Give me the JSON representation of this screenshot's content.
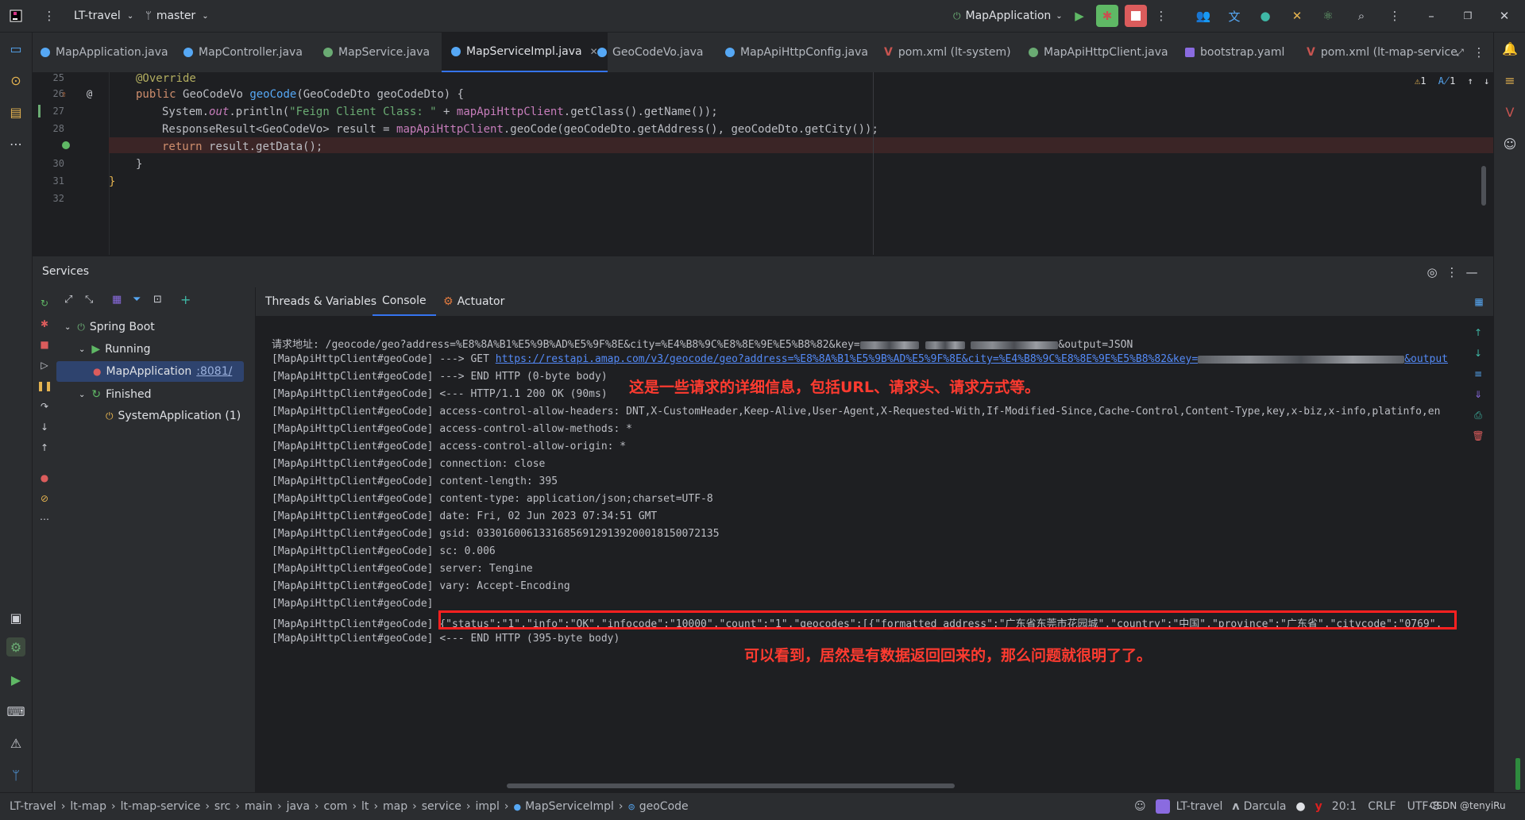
{
  "titlebar": {
    "project": "LT-travel",
    "branch": "master",
    "run_config": "MapApplication"
  },
  "tabs": [
    {
      "label": "MapApplication.java",
      "icon": "java-class-icon",
      "color": "#56a8f5"
    },
    {
      "label": "MapController.java",
      "icon": "java-class-icon",
      "color": "#56a8f5"
    },
    {
      "label": "MapService.java",
      "icon": "java-interface-icon",
      "color": "#6aab73"
    },
    {
      "label": "MapServiceImpl.java",
      "icon": "java-class-icon",
      "color": "#56a8f5",
      "active": true
    },
    {
      "label": "GeoCodeVo.java",
      "icon": "java-class-icon",
      "color": "#56a8f5"
    },
    {
      "label": "MapApiHttpConfig.java",
      "icon": "java-class-icon",
      "color": "#56a8f5"
    },
    {
      "label": "pom.xml (lt-system)",
      "icon": "maven-icon",
      "color": "#c75450"
    },
    {
      "label": "MapApiHttpClient.java",
      "icon": "java-interface-icon",
      "color": "#6aab73"
    },
    {
      "label": "bootstrap.yaml",
      "icon": "yaml-icon",
      "color": "#8a6be0"
    },
    {
      "label": "pom.xml (lt-map-service",
      "icon": "maven-icon",
      "color": "#c75450"
    }
  ],
  "editor": {
    "lines": [
      {
        "n": "25",
        "text": "@Override"
      },
      {
        "n": "26",
        "text": "public GeoCodeVo geoCode(GeoCodeDto geoCodeDto) {"
      },
      {
        "n": "27",
        "text": "System.out.println(\"Feign Client Class: \" + mapApiHttpClient.getClass().getName());"
      },
      {
        "n": "28",
        "text": "ResponseResult<GeoCodeVo> result = mapApiHttpClient.geoCode(geoCodeDto.getAddress(), geoCodeDto.getCity());"
      },
      {
        "n": "",
        "text": "return result.getData();"
      },
      {
        "n": "30",
        "text": "}"
      },
      {
        "n": "31",
        "text": "}"
      },
      {
        "n": "32",
        "text": ""
      }
    ],
    "inspections": {
      "warnings": "1",
      "typos": "1"
    }
  },
  "services": {
    "title": "Services",
    "tree": {
      "root": "Spring Boot",
      "running": "Running",
      "running_app": "MapApplication",
      "running_port": ":8081/",
      "finished": "Finished",
      "finished_app": "SystemApplication (1)"
    },
    "console_tabs": [
      "Threads & Variables",
      "Console",
      "Actuator"
    ],
    "active_console_tab": "Console"
  },
  "console": {
    "line0_prefix": "请求地址: /geocode/geo?address=%E8%8A%B1%E5%9B%AD%E5%9F%8E&city=%E4%B8%9C%E8%8E%9E%E5%B8%82&key=",
    "line0_suffix": "&output=JSON",
    "line1_prefix": "[MapApiHttpClient#geoCode] ---> GET ",
    "line1_url": "https://restapi.amap.com/v3/geocode/geo?address=%E8%8A%B1%E5%9B%AD%E5%9F%8E&city=%E4%B8%9C%E8%8E%9E%E5%B8%82&key=",
    "line1_suffix": "&output",
    "lines": [
      "[MapApiHttpClient#geoCode] ---> END HTTP (0-byte body)",
      "[MapApiHttpClient#geoCode] <--- HTTP/1.1 200 OK (90ms)",
      "[MapApiHttpClient#geoCode] access-control-allow-headers: DNT,X-CustomHeader,Keep-Alive,User-Agent,X-Requested-With,If-Modified-Since,Cache-Control,Content-Type,key,x-biz,x-info,platinfo,en",
      "[MapApiHttpClient#geoCode] access-control-allow-methods: *",
      "[MapApiHttpClient#geoCode] access-control-allow-origin: *",
      "[MapApiHttpClient#geoCode] connection: close",
      "[MapApiHttpClient#geoCode] content-length: 395",
      "[MapApiHttpClient#geoCode] content-type: application/json;charset=UTF-8",
      "[MapApiHttpClient#geoCode] date: Fri, 02 Jun 2023 07:34:51 GMT",
      "[MapApiHttpClient#geoCode] gsid: 033016006133168569129139200018150072135",
      "[MapApiHttpClient#geoCode] sc: 0.006",
      "[MapApiHttpClient#geoCode] server: Tengine",
      "[MapApiHttpClient#geoCode] vary: Accept-Encoding",
      "[MapApiHttpClient#geoCode]"
    ],
    "body_prefix": "[MapApiHttpClient#geoCode] ",
    "body_json": "{\"status\":\"1\",\"info\":\"OK\",\"infocode\":\"10000\",\"count\":\"1\",\"geocodes\":[{\"formatted_address\":\"广东省东莞市花园城\",\"country\":\"中国\",\"province\":\"广东省\",\"citycode\":\"0769\",",
    "end_line": "[MapApiHttpClient#geoCode] <--- END HTTP (395-byte body)",
    "annotation_1": "这是一些请求的详细信息，包括URL、请求头、请求方式等。",
    "annotation_2": "可以看到，居然是有数据返回回来的，那么问题就很明了了。",
    "annotation_color": "#ff3b30"
  },
  "statusbar": {
    "breadcrumbs": [
      "LT-travel",
      "lt-map",
      "lt-map-service",
      "src",
      "main",
      "java",
      "com",
      "lt",
      "map",
      "service",
      "impl",
      "MapServiceImpl",
      "geoCode"
    ],
    "project": "LT-travel",
    "theme": "Darcula",
    "position": "20:1",
    "line_sep": "CRLF",
    "encoding": "UTF-8",
    "watermark": "CSDN @tenyiRu"
  }
}
